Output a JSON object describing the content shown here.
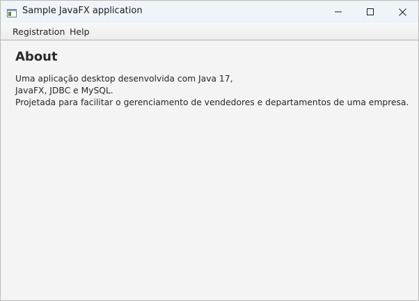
{
  "window": {
    "title": "Sample JavaFX application",
    "app_icon": "javafx-window-icon",
    "controls": {
      "minimize_icon": "minimize-icon",
      "maximize_icon": "maximize-icon",
      "close_icon": "close-icon"
    }
  },
  "menubar": {
    "items": [
      {
        "label": "Registration"
      },
      {
        "label": "Help"
      }
    ]
  },
  "about": {
    "title": "About",
    "lines": [
      "Uma aplicação desktop desenvolvida com Java 17,",
      "JavaFX, JDBC e MySQL.",
      "Projetada para facilitar o gerenciamento de vendedores e departamentos de uma empresa."
    ]
  },
  "colors": {
    "titlebar_bg": "#eff4f9",
    "content_bg": "#f4f4f4",
    "text": "#262626"
  }
}
